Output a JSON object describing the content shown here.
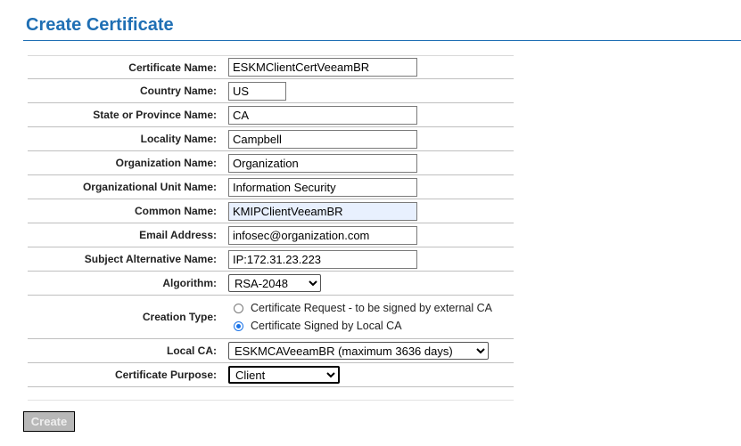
{
  "page": {
    "title": "Create Certificate"
  },
  "form": {
    "certificate_name": {
      "label": "Certificate Name:",
      "value": "ESKMClientCertVeeamBR"
    },
    "country_name": {
      "label": "Country Name:",
      "value": "US"
    },
    "state_name": {
      "label": "State or Province Name:",
      "value": "CA"
    },
    "locality_name": {
      "label": "Locality Name:",
      "value": "Campbell"
    },
    "organization_name": {
      "label": "Organization Name:",
      "value": "Organization"
    },
    "org_unit_name": {
      "label": "Organizational Unit Name:",
      "value": "Information Security"
    },
    "common_name": {
      "label": "Common Name:",
      "value": "KMIPClientVeeamBR"
    },
    "email_address": {
      "label": "Email Address:",
      "value": "infosec@organization.com"
    },
    "subject_alt_name": {
      "label": "Subject Alternative Name:",
      "value": "IP:172.31.23.223"
    },
    "algorithm": {
      "label": "Algorithm:",
      "value": "RSA-2048"
    },
    "creation_type": {
      "label": "Creation Type:",
      "options": [
        {
          "label": "Certificate Request - to be signed by external CA",
          "selected": false
        },
        {
          "label": "Certificate Signed by Local CA",
          "selected": true
        }
      ]
    },
    "local_ca": {
      "label": "Local CA:",
      "value": "ESKMCAVeeamBR (maximum 3636 days)"
    },
    "certificate_purpose": {
      "label": "Certificate Purpose:",
      "value": "Client"
    }
  },
  "actions": {
    "create_label": "Create"
  },
  "colors": {
    "title": "#1f6fb4",
    "button_bg": "#b8b8b8",
    "radio_selected": "#1a73e8"
  }
}
